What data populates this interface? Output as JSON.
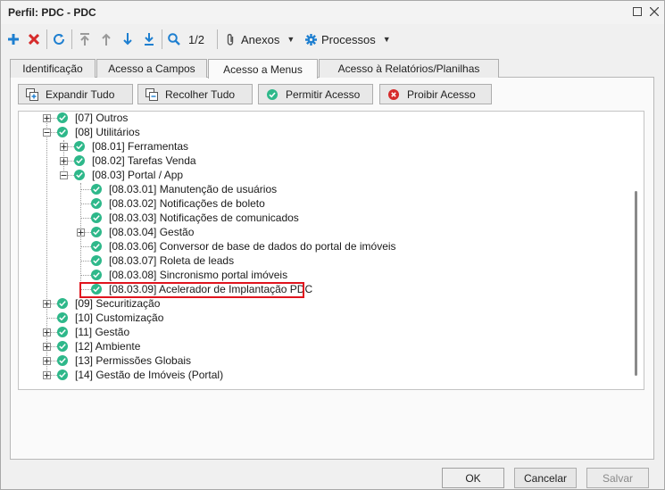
{
  "window": {
    "title": "Perfil: PDC - PDC"
  },
  "toolbar": {
    "page_indicator": "1/2",
    "anexos_label": "Anexos",
    "processos_label": "Processos"
  },
  "tabs": [
    {
      "label": "Identificação"
    },
    {
      "label": "Acesso a Campos"
    },
    {
      "label": "Acesso a Menus",
      "active": true
    },
    {
      "label": "Acesso à Relatórios/Planilhas"
    }
  ],
  "actions": {
    "expandir": "Expandir Tudo",
    "recolher": "Recolher Tudo",
    "permitir": "Permitir Acesso",
    "proibir": "Proibir Acesso"
  },
  "tree": [
    {
      "label": "[07] Outros",
      "status": "allowed"
    },
    {
      "label": "[08] Utilitários",
      "status": "allowed"
    },
    {
      "label": "[08.01] Ferramentas",
      "status": "allowed"
    },
    {
      "label": "[08.02] Tarefas Venda",
      "status": "allowed"
    },
    {
      "label": "[08.03] Portal / App",
      "status": "allowed"
    },
    {
      "label": "[08.03.01] Manutenção de usuários",
      "status": "allowed"
    },
    {
      "label": "[08.03.02] Notificações de boleto",
      "status": "allowed"
    },
    {
      "label": "[08.03.03] Notificações de comunicados",
      "status": "allowed"
    },
    {
      "label": "[08.03.04] Gestão",
      "status": "allowed"
    },
    {
      "label": "[08.03.06] Conversor de base de dados do portal de imóveis",
      "status": "allowed"
    },
    {
      "label": "[08.03.07] Roleta de leads",
      "status": "allowed"
    },
    {
      "label": "[08.03.08] Sincronismo portal imóveis",
      "status": "allowed"
    },
    {
      "label": "[08.03.09] Acelerador de Implantação PDC",
      "status": "allowed",
      "highlighted": true
    },
    {
      "label": "[09] Securitização",
      "status": "allowed"
    },
    {
      "label": "[10] Customização",
      "status": "allowed"
    },
    {
      "label": "[11] Gestão",
      "status": "allowed"
    },
    {
      "label": "[12] Ambiente",
      "status": "allowed"
    },
    {
      "label": "[13] Permissões Globais",
      "status": "allowed"
    },
    {
      "label": "[14] Gestão de Imóveis (Portal)",
      "status": "allowed"
    }
  ],
  "footer": {
    "ok": "OK",
    "cancel": "Cancelar",
    "save": "Salvar"
  },
  "colors": {
    "check": "#2eb88a",
    "highlight": "#e0141e",
    "add_icon": "#1e7fd0",
    "delete_icon": "#d62b2b"
  }
}
